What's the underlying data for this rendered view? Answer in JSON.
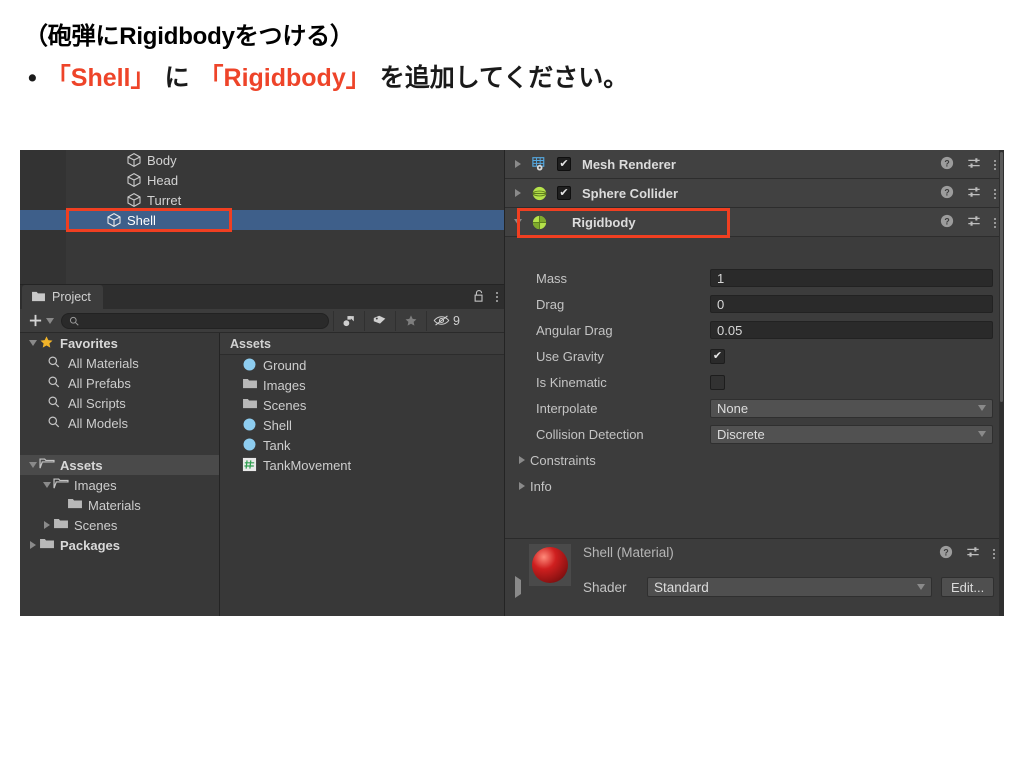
{
  "slide": {
    "title": "（砲弾にRigidbodyをつける）",
    "bullet_dot": "•",
    "bullet_part1": "「Shell」",
    "bullet_part2": "に",
    "bullet_part3": "「Rigidbody」",
    "bullet_part4": "を追加してください。",
    "highlight_color": "#ee4429"
  },
  "hierarchy": {
    "rows": [
      {
        "label": "Body",
        "icon": "cube-icon",
        "selected": false
      },
      {
        "label": "Head",
        "icon": "cube-icon",
        "selected": false
      },
      {
        "label": "Turret",
        "icon": "cube-icon",
        "selected": false
      },
      {
        "label": "Shell",
        "icon": "cube-icon",
        "selected": true
      }
    ]
  },
  "project": {
    "tab_label": "Project",
    "tab_icon": "folder-icon",
    "lock_icon": "lock-open-icon",
    "menu_icon": "kebab-menu-icon",
    "add_label": "+",
    "search_placeholder": "",
    "search_value": "",
    "toolbar_icons": [
      "object-filter-icon",
      "tag-filter-icon",
      "favorite-star-icon",
      "hidden-eye-icon"
    ],
    "hidden_count": "9",
    "tree": [
      {
        "label": "Favorites",
        "icon": "star-icon",
        "arrow": "down",
        "indent": 0,
        "bold": true
      },
      {
        "label": "All Materials",
        "icon": "search-icon",
        "arrow": "none",
        "indent": 1,
        "bold": false
      },
      {
        "label": "All Prefabs",
        "icon": "search-icon",
        "arrow": "none",
        "indent": 1,
        "bold": false
      },
      {
        "label": "All Scripts",
        "icon": "search-icon",
        "arrow": "none",
        "indent": 1,
        "bold": false
      },
      {
        "label": "All Models",
        "icon": "search-icon",
        "arrow": "none",
        "indent": 1,
        "bold": false
      },
      {
        "label": "",
        "icon": "none",
        "arrow": "none",
        "indent": 0,
        "bold": false
      },
      {
        "label": "Assets",
        "icon": "folder-open-icon",
        "arrow": "down",
        "indent": 0,
        "bold": true,
        "highlight": true
      },
      {
        "label": "Images",
        "icon": "folder-open-icon",
        "arrow": "down",
        "indent": 1,
        "bold": false
      },
      {
        "label": "Materials",
        "icon": "folder-icon",
        "arrow": "none",
        "indent": 2,
        "bold": false
      },
      {
        "label": "Scenes",
        "icon": "folder-icon",
        "arrow": "right",
        "indent": 1,
        "bold": false
      },
      {
        "label": "Packages",
        "icon": "folder-icon",
        "arrow": "right",
        "indent": 0,
        "bold": true
      }
    ],
    "assets_header": "Assets",
    "assets": [
      {
        "label": "Ground",
        "icon": "prefab-icon"
      },
      {
        "label": "Images",
        "icon": "folder-icon"
      },
      {
        "label": "Scenes",
        "icon": "folder-icon"
      },
      {
        "label": "Shell",
        "icon": "prefab-icon"
      },
      {
        "label": "Tank",
        "icon": "prefab-icon"
      },
      {
        "label": "TankMovement",
        "icon": "csharp-script-icon"
      }
    ]
  },
  "inspector": {
    "components": [
      {
        "title": "Mesh Renderer",
        "icon": "mesh-renderer-icon",
        "enabled": true,
        "has_checkbox": true,
        "expanded": false
      },
      {
        "title": "Sphere Collider",
        "icon": "sphere-collider-icon",
        "enabled": true,
        "has_checkbox": true,
        "expanded": false
      },
      {
        "title": "Rigidbody",
        "icon": "rigidbody-icon",
        "enabled": true,
        "has_checkbox": false,
        "expanded": true
      }
    ],
    "header_icons": [
      "help-icon",
      "preset-icon",
      "kebab-menu-icon"
    ],
    "rigidbody": {
      "mass_label": "Mass",
      "mass_value": "1",
      "drag_label": "Drag",
      "drag_value": "0",
      "angular_drag_label": "Angular Drag",
      "angular_drag_value": "0.05",
      "use_gravity_label": "Use Gravity",
      "use_gravity_checked": "✔",
      "is_kinematic_label": "Is Kinematic",
      "interpolate_label": "Interpolate",
      "interpolate_value": "None",
      "collision_detection_label": "Collision Detection",
      "collision_detection_value": "Discrete",
      "constraints_label": "Constraints",
      "info_label": "Info"
    },
    "material": {
      "title": "Shell (Material)",
      "shader_label": "Shader",
      "shader_value": "Standard",
      "edit_label": "Edit...",
      "preview_icon": "material-sphere-preview"
    }
  },
  "annotations": {
    "shell_row_box_color": "#f03f21",
    "rigidbody_header_box_color": "#f03f21"
  }
}
